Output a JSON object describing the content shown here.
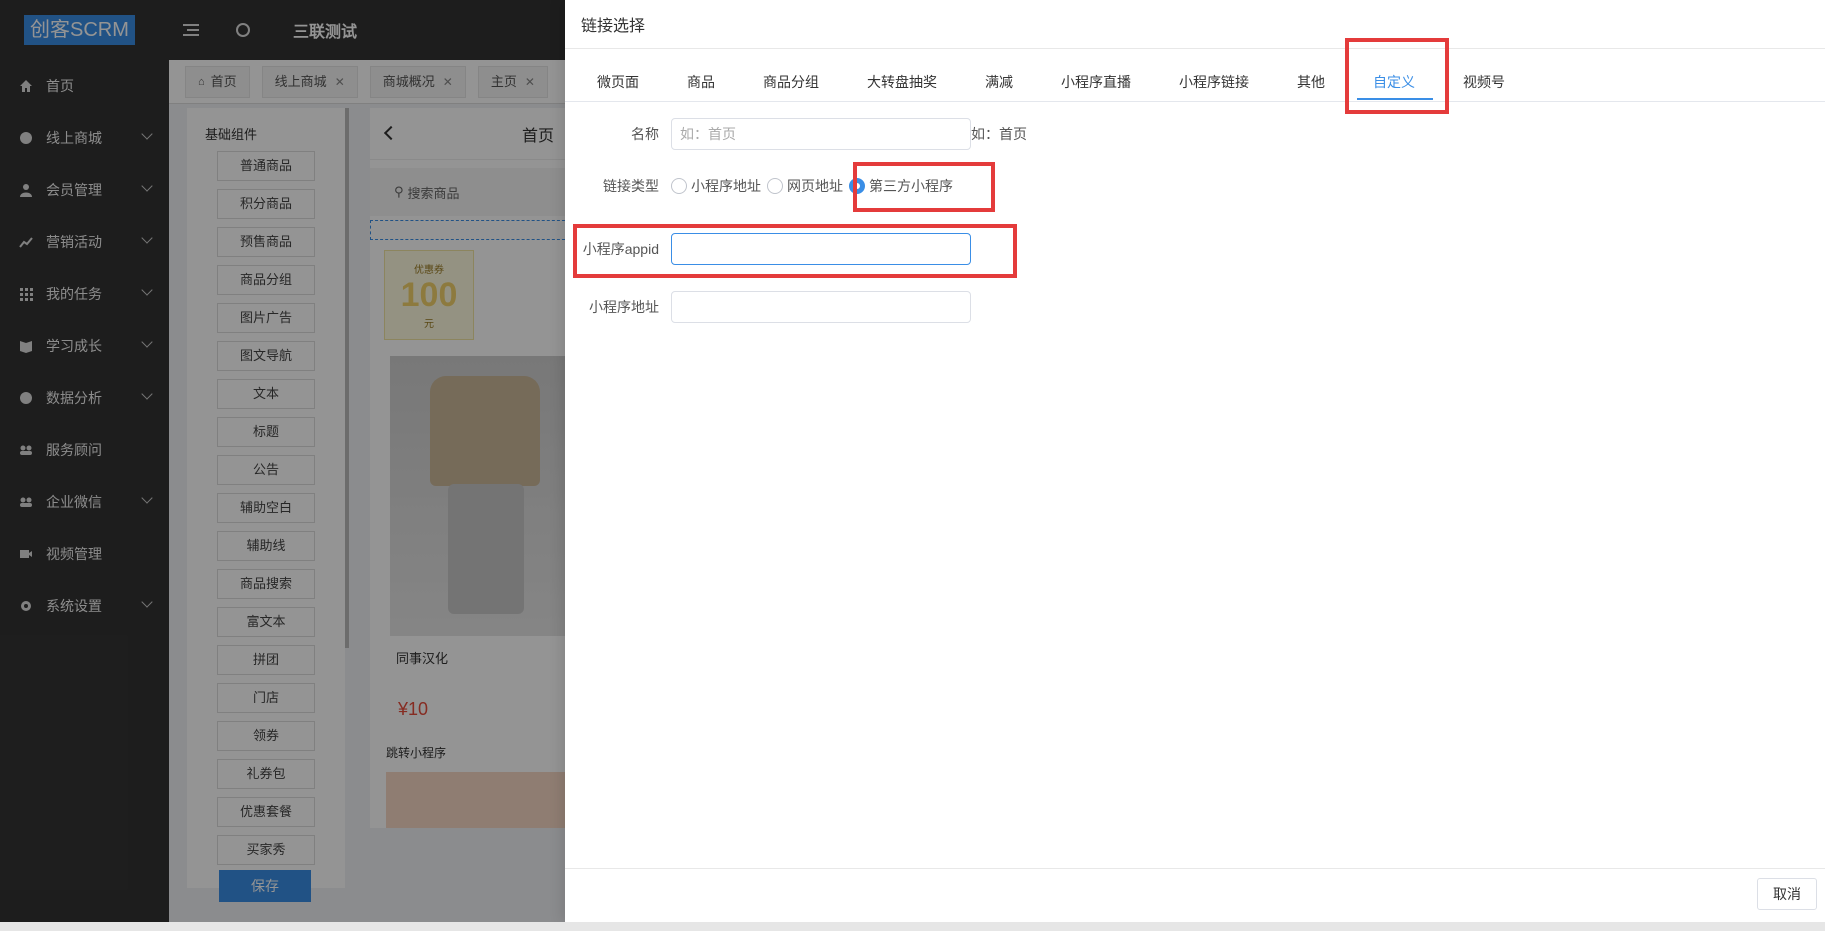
{
  "app": {
    "logo": "创客SCRM",
    "header_title": "三联测试"
  },
  "sidebar": {
    "items": [
      {
        "label": "首页",
        "icon": "home-icon",
        "has_arrow": false
      },
      {
        "label": "线上商城",
        "icon": "mall-icon",
        "has_arrow": true
      },
      {
        "label": "会员管理",
        "icon": "user-icon",
        "has_arrow": true
      },
      {
        "label": "营销活动",
        "icon": "trend-icon",
        "has_arrow": true
      },
      {
        "label": "我的任务",
        "icon": "grid-icon",
        "has_arrow": true
      },
      {
        "label": "学习成长",
        "icon": "book-icon",
        "has_arrow": true
      },
      {
        "label": "数据分析",
        "icon": "pie-icon",
        "has_arrow": true
      },
      {
        "label": "服务顾问",
        "icon": "team-icon",
        "has_arrow": false
      },
      {
        "label": "企业微信",
        "icon": "wechat-icon",
        "has_arrow": true
      },
      {
        "label": "视频管理",
        "icon": "video-icon",
        "has_arrow": false
      },
      {
        "label": "系统设置",
        "icon": "gear-icon",
        "has_arrow": true
      }
    ]
  },
  "tabs": [
    {
      "label": "首页",
      "closable": false
    },
    {
      "label": "线上商城",
      "closable": true
    },
    {
      "label": "商城概况",
      "closable": true
    },
    {
      "label": "主页",
      "closable": true
    }
  ],
  "components": {
    "title": "基础组件",
    "items": [
      "普通商品",
      "积分商品",
      "预售商品",
      "商品分组",
      "图片广告",
      "图文导航",
      "文本",
      "标题",
      "公告",
      "辅助空白",
      "辅助线",
      "商品搜索",
      "富文本",
      "拼团",
      "门店",
      "领券",
      "礼券包",
      "优惠套餐",
      "买家秀"
    ],
    "save_label": "保存"
  },
  "phone": {
    "title": "首页",
    "search_placeholder": "搜索商品",
    "coupon_title": "优惠券",
    "coupon_amount": "100",
    "coupon_unit": "元",
    "product_name": "同事汉化",
    "product_price": "¥10",
    "jump_label": "跳转小程序"
  },
  "drawer": {
    "title": "链接选择",
    "tabs": [
      "微页面",
      "商品",
      "商品分组",
      "大转盘抽奖",
      "满减",
      "小程序直播",
      "小程序链接",
      "其他",
      "自定义",
      "视频号"
    ],
    "active_tab": "自定义",
    "form": {
      "name_label": "名称",
      "name_placeholder": "如：首页",
      "name_hint": "如：首页",
      "type_label": "链接类型",
      "type_options": [
        "小程序地址",
        "网页地址",
        "第三方小程序"
      ],
      "type_selected": "第三方小程序",
      "appid_label": "小程序appid",
      "appid_value": "",
      "path_label": "小程序地址",
      "path_value": ""
    },
    "cancel_label": "取消"
  },
  "colors": {
    "accent": "#3a8ee6",
    "highlight": "#e43b3b",
    "sidebar_bg": "#333333"
  }
}
